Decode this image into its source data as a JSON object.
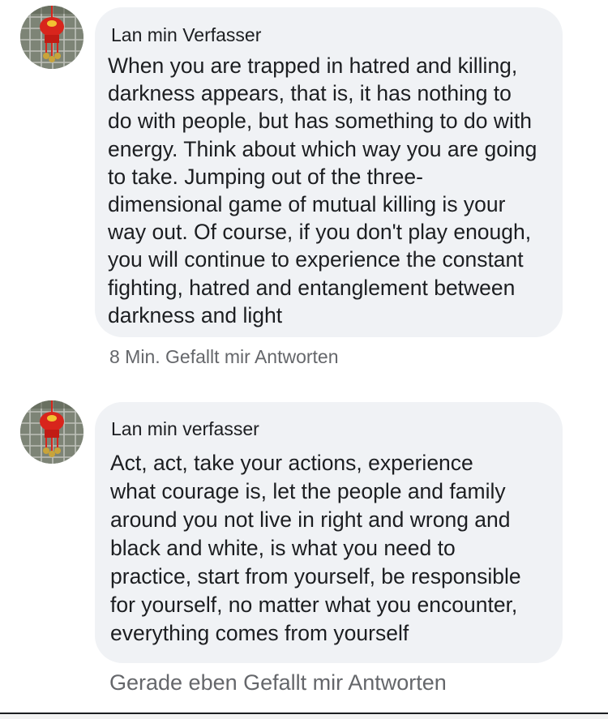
{
  "comments": [
    {
      "author": "Lan min Verfasser",
      "lines": [
        "When you are trapped in hatred and killing,",
        "darkness appears, that is, it has nothing to",
        "do with people, but has something to do with",
        "energy. Think about which way you are going",
        "to take. Jumping out of the three-",
        "dimensional game of mutual killing is your",
        "way out. Of course, if you don't play enough,",
        "you will continue to experience the constant",
        "fighting, hatred and entanglement between",
        "darkness and light"
      ],
      "time": "8 Min.",
      "like_label": "Gefallt mir",
      "reply_label": "Antworten"
    },
    {
      "author": "Lan min verfasser",
      "lines": [
        "Act, act, take your actions, experience",
        "what courage is, let the people and family",
        "around you not live in right and wrong and",
        "black and white, is what you need to",
        "practice, start from yourself, be responsible",
        "for yourself, no matter what you encounter,",
        "everything comes from yourself"
      ],
      "time": "Gerade eben",
      "like_label": "Gefallt mir",
      "reply_label": "Antworten"
    }
  ],
  "colors": {
    "bubble_bg": "#f0f2f5",
    "text": "#1c1e21",
    "meta_text": "#65676b",
    "avatar_ornament": "#d8251c"
  },
  "icons": {
    "avatar": "profile-photo-red-ornament"
  }
}
